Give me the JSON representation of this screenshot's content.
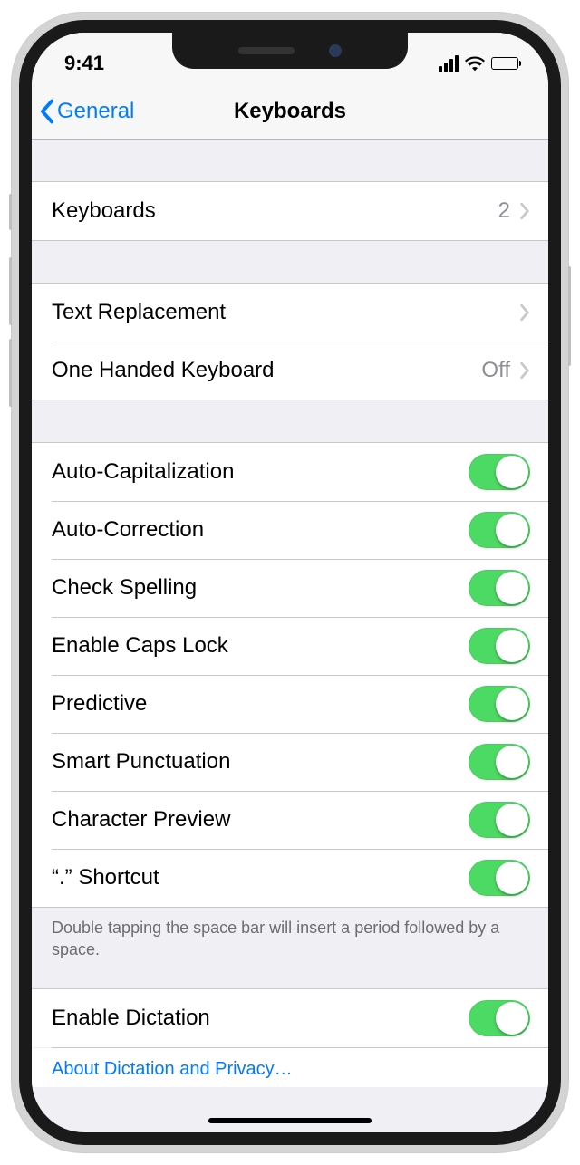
{
  "status": {
    "time": "9:41"
  },
  "nav": {
    "back": "General",
    "title": "Keyboards"
  },
  "sections": {
    "keyboards": {
      "label": "Keyboards",
      "count": "2"
    },
    "text_replacement": {
      "label": "Text Replacement"
    },
    "one_handed": {
      "label": "One Handed Keyboard",
      "value": "Off"
    }
  },
  "toggles": {
    "auto_cap": "Auto-Capitalization",
    "auto_correct": "Auto-Correction",
    "check_spell": "Check Spelling",
    "caps_lock": "Enable Caps Lock",
    "predictive": "Predictive",
    "smart_punct": "Smart Punctuation",
    "char_preview": "Character Preview",
    "dot_shortcut": "“.” Shortcut"
  },
  "footer": "Double tapping the space bar will insert a period followed by a space.",
  "dictation": {
    "enable": "Enable Dictation",
    "about": "About Dictation and Privacy…"
  }
}
